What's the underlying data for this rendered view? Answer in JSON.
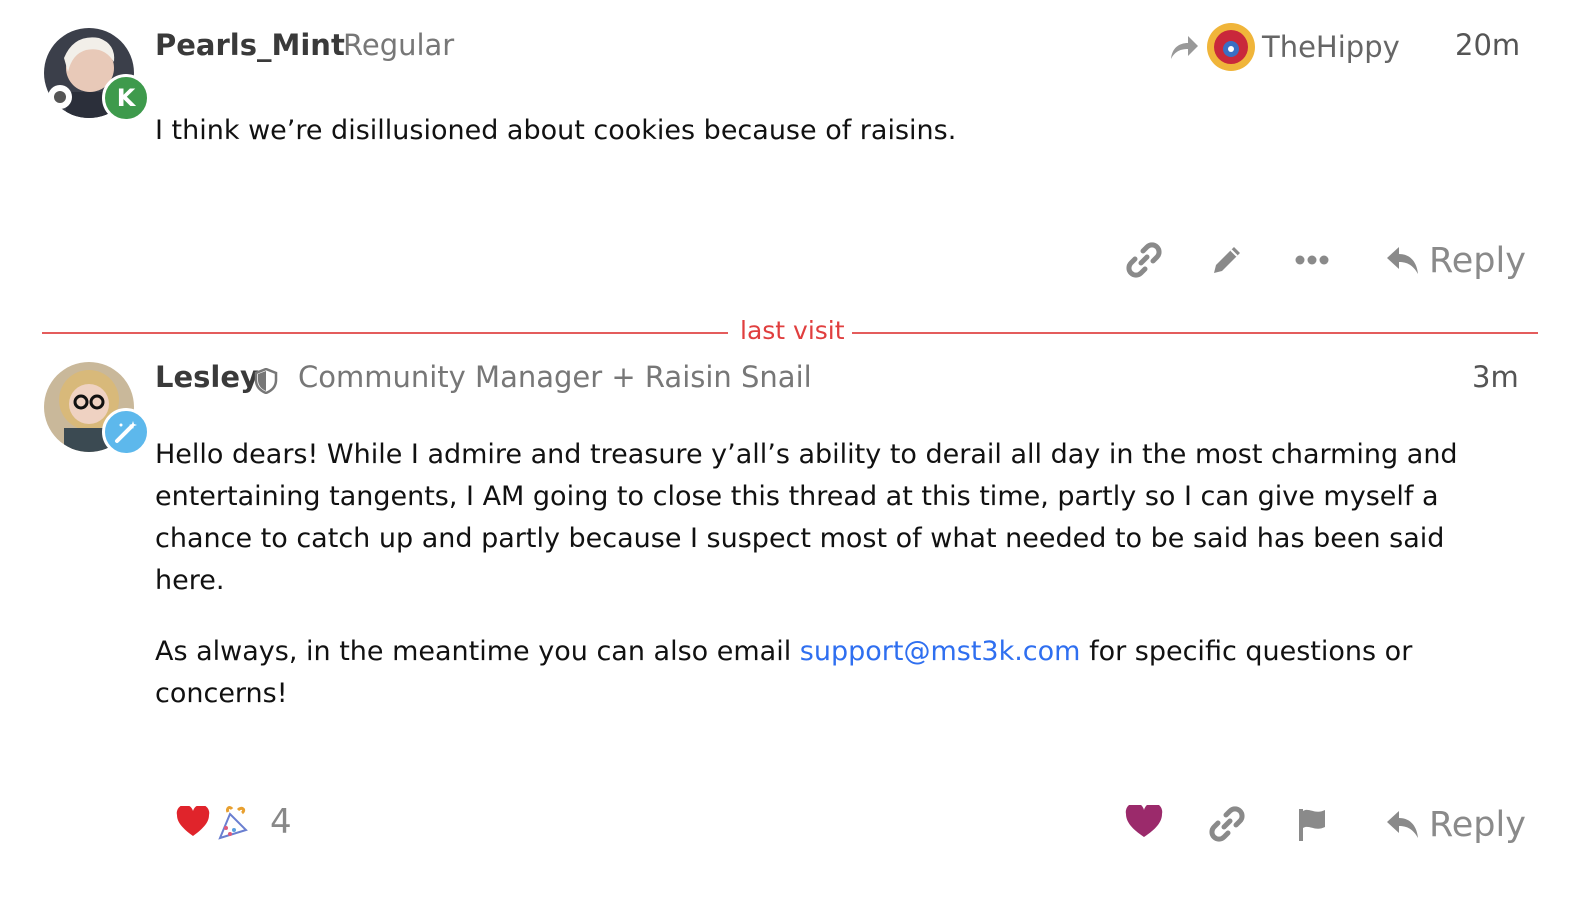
{
  "posts": [
    {
      "username": "Pearls_Mint",
      "user_title": "Regular",
      "reply_to": "TheHippy",
      "time": "20m",
      "flair_letter": "K",
      "body": [
        "I think we’re disillusioned about cookies because of raisins."
      ],
      "actions": {
        "reply": "Reply"
      },
      "icons": [
        "link-icon",
        "pencil-icon",
        "more-icon",
        "reply-icon"
      ]
    },
    {
      "username": "Lesley",
      "user_title": "Community Manager + Raisin Snail",
      "time": "3m",
      "body": [
        "Hello dears! While I admire and treasure y’all’s ability to derail all day in the most charming and entertaining tangents, I AM going to close this thread at this time, partly so I can give myself a chance to catch up and partly because I suspect most of what needed to be said has been said here."
      ],
      "body2_prefix": "As always, in the meantime you can also email ",
      "email": "support@mst3k.com",
      "body2_suffix": " for specific questions or concerns!",
      "reactions": {
        "emojis": [
          "❤️",
          "🎊"
        ],
        "count": "4"
      },
      "actions": {
        "reply": "Reply"
      },
      "icons": [
        "heart-icon",
        "link-icon",
        "flag-icon",
        "reply-icon"
      ]
    }
  ],
  "divider": {
    "label": "last visit"
  },
  "colors": {
    "divider": "#e45c5c",
    "link": "#2f6ff0",
    "heart": "#9b2a6b",
    "flair_green": "#3e9a4c",
    "flair_blue": "#5db8ec"
  }
}
